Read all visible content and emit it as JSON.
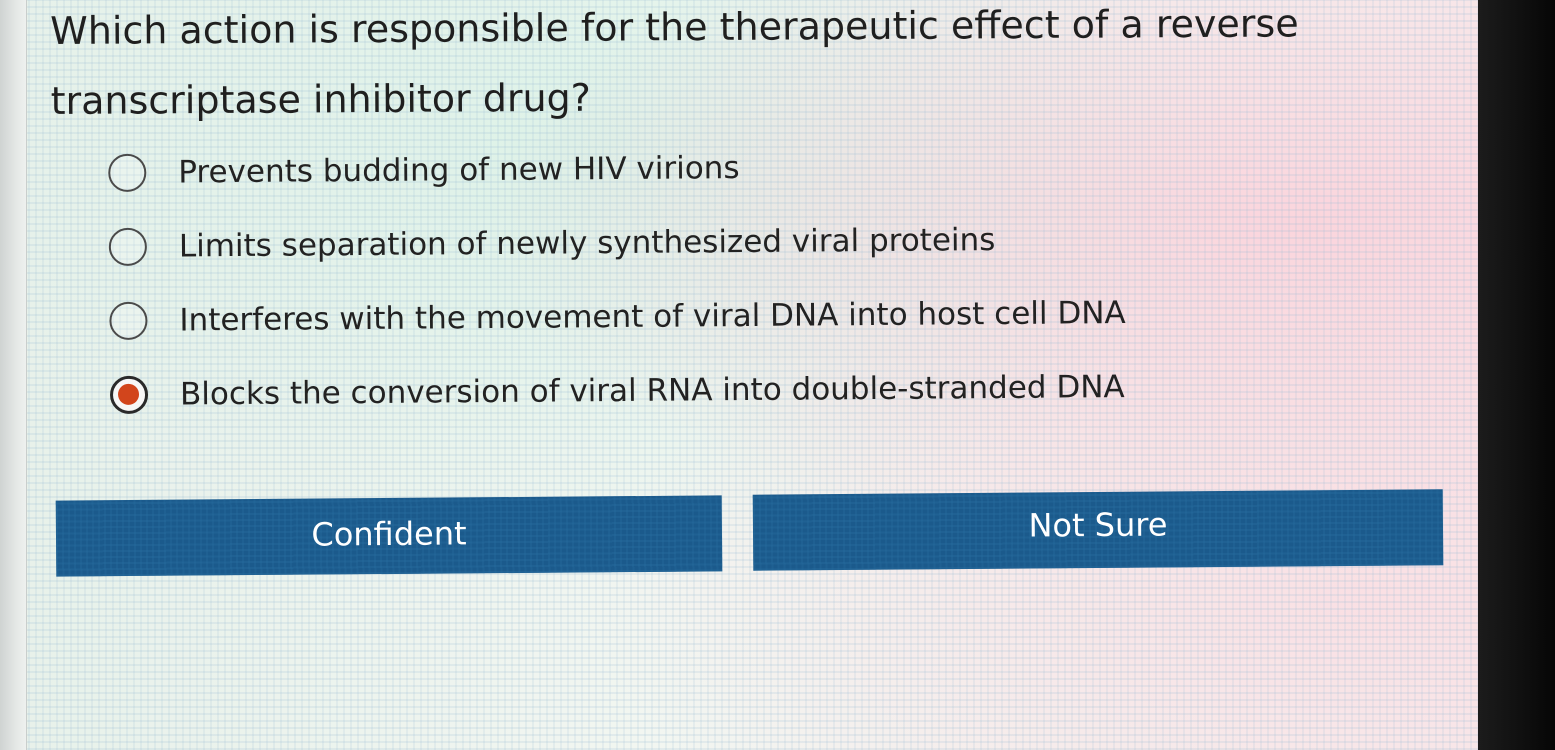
{
  "question": {
    "text": "Which action is responsible for the therapeutic effect of a reverse transcriptase inhibitor drug?"
  },
  "options": [
    {
      "label": "Prevents budding of new HIV virions",
      "selected": false
    },
    {
      "label": "Limits separation of newly synthesized viral proteins",
      "selected": false
    },
    {
      "label": "Interferes with the movement of viral DNA into host cell DNA",
      "selected": false
    },
    {
      "label": "Blocks the conversion of viral RNA into double-stranded DNA",
      "selected": true
    }
  ],
  "buttons": {
    "confident_label": "Confident",
    "not_sure_label": "Not Sure"
  },
  "colors": {
    "button_background": "#1b5a8c",
    "button_text": "#ffffff",
    "selected_radio_dot": "#d2451c",
    "text": "#222222"
  }
}
